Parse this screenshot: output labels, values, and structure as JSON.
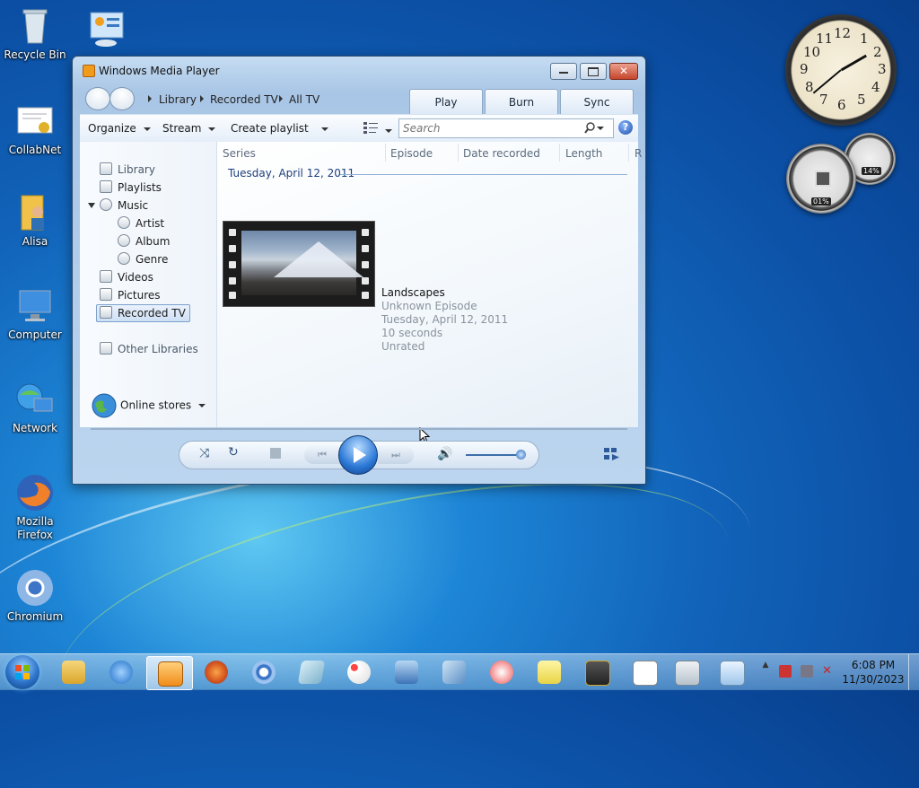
{
  "desktop": {
    "icons": [
      {
        "label": "Recycle Bin"
      },
      {
        "label": "CollabNet"
      },
      {
        "label": "Alisa"
      },
      {
        "label": "Computer"
      },
      {
        "label": "Network"
      },
      {
        "label": "Mozilla Firefox"
      },
      {
        "label": "Chromium"
      }
    ]
  },
  "window": {
    "title": "Windows Media Player",
    "breadcrumb": [
      "Library",
      "Recorded TV",
      "All TV"
    ],
    "tabs": [
      "Play",
      "Burn",
      "Sync"
    ],
    "toolbar": {
      "organize": "Organize",
      "stream": "Stream",
      "create_playlist": "Create playlist",
      "search_placeholder": "Search",
      "help": "?"
    },
    "nav": {
      "library": "Library",
      "playlists": "Playlists",
      "music": "Music",
      "artist": "Artist",
      "album": "Album",
      "genre": "Genre",
      "videos": "Videos",
      "pictures": "Pictures",
      "recorded_tv": "Recorded TV",
      "other_libraries": "Other Libraries",
      "online_stores": "Online stores"
    },
    "columns": [
      "Series",
      "Episode",
      "Date recorded",
      "Length",
      "R"
    ],
    "group_header": "Tuesday, April 12, 2011",
    "item": {
      "title": "Landscapes",
      "episode": "Unknown Episode",
      "date": "Tuesday, April 12, 2011",
      "length": "10 seconds",
      "rating": "Unrated"
    }
  },
  "gadgets": {
    "clock_numbers": [
      "12",
      "1",
      "2",
      "3",
      "4",
      "5",
      "6",
      "7",
      "8",
      "9",
      "10",
      "11"
    ],
    "cpu": "01%",
    "mem": "14%"
  },
  "taskbar": {
    "time": "6:08 PM",
    "date": "11/30/2023"
  }
}
